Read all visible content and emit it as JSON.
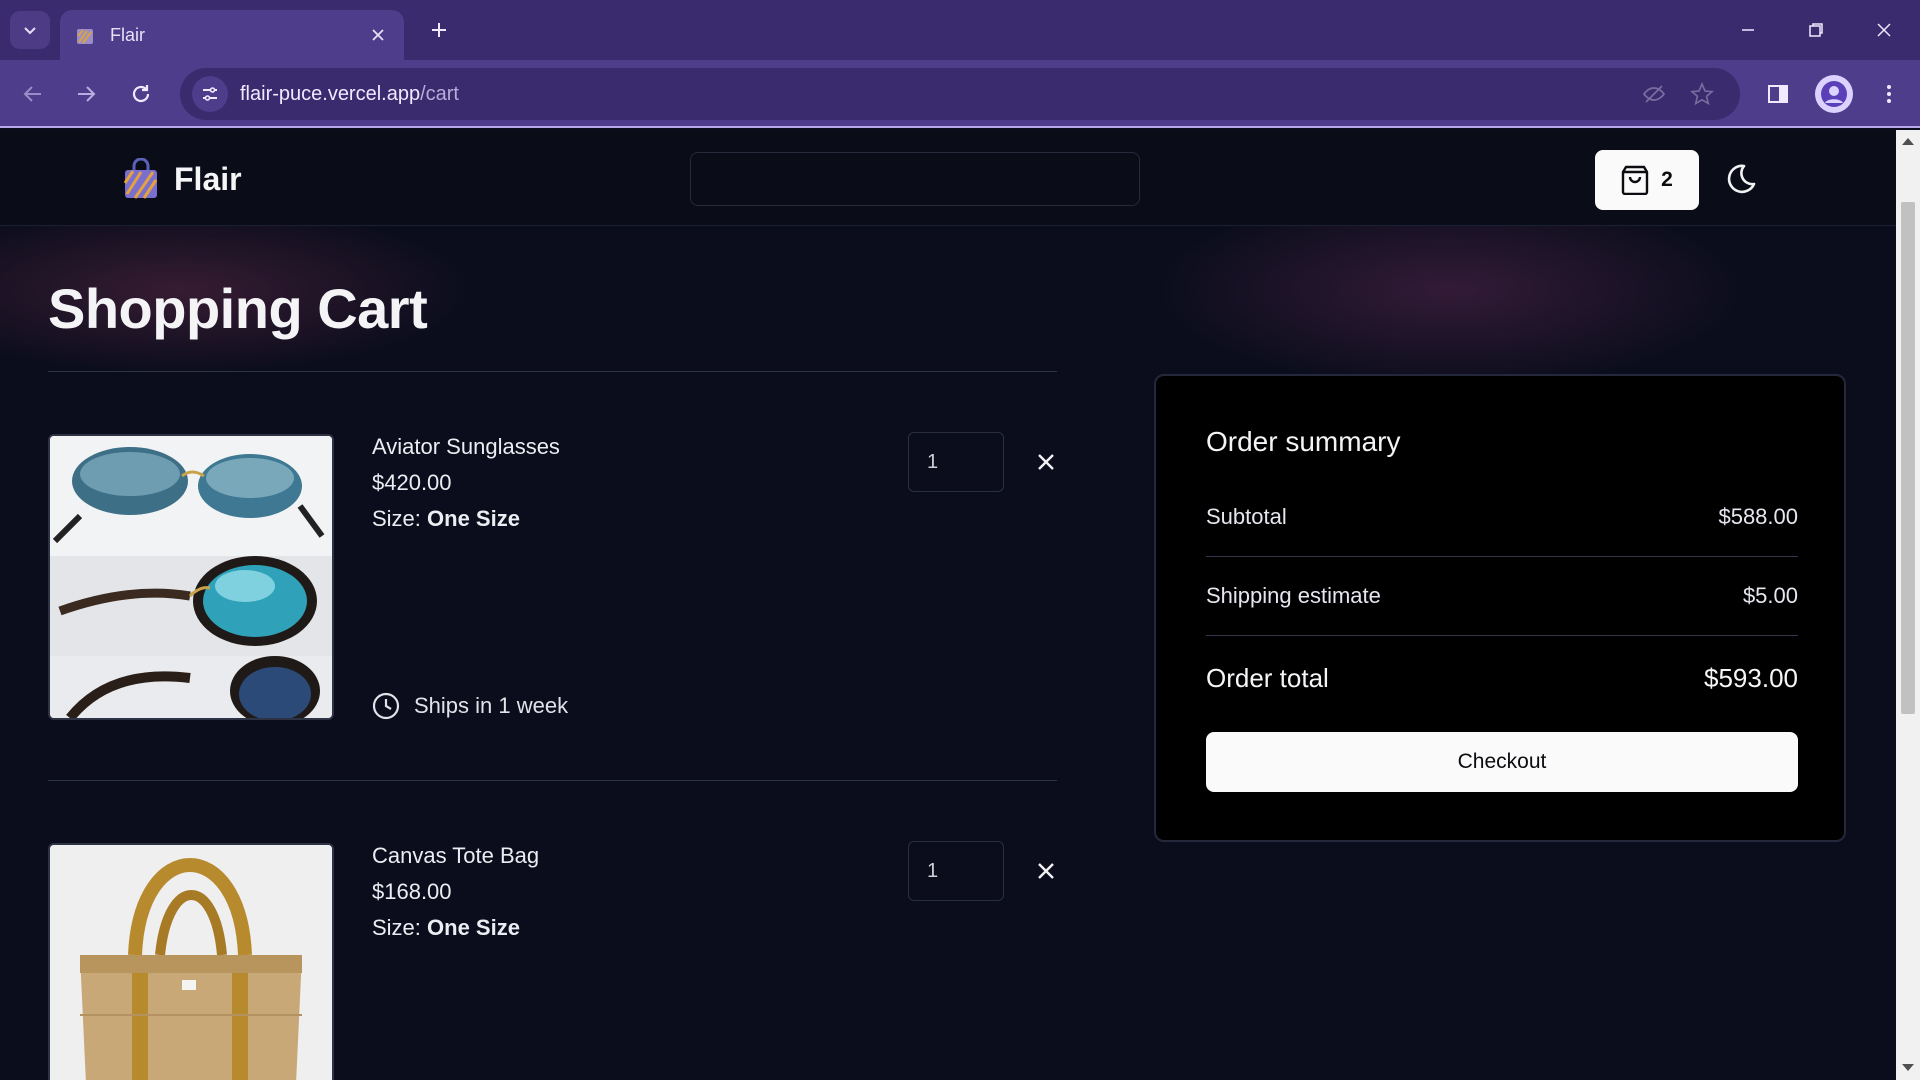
{
  "browser": {
    "tab_title": "Flair",
    "url_domain": "flair-puce.vercel.app",
    "url_path": "/cart"
  },
  "site": {
    "logo_name": "Flair",
    "cart_count": "2"
  },
  "page_title": "Shopping Cart",
  "cart_items": [
    {
      "name": "Aviator Sunglasses",
      "price": "$420.00",
      "size_label": "Size: ",
      "size_value": "One Size",
      "quantity": "1",
      "shipping": "Ships in 1 week"
    },
    {
      "name": "Canvas Tote Bag",
      "price": "$168.00",
      "size_label": "Size: ",
      "size_value": "One Size",
      "quantity": "1"
    }
  ],
  "summary": {
    "title": "Order summary",
    "subtotal_label": "Subtotal",
    "subtotal_value": "$588.00",
    "shipping_label": "Shipping estimate",
    "shipping_value": "$5.00",
    "total_label": "Order total",
    "total_value": "$593.00",
    "checkout_label": "Checkout"
  },
  "colors": {
    "browser_tabbar": "#3a2a6e",
    "browser_toolbar": "#4e3d8a",
    "page_background": "#0b0d1c",
    "summary_background": "#000000",
    "button_light": "#fafafa"
  },
  "icons": [
    "tab-search-icon",
    "favicon",
    "close-icon",
    "plus-icon",
    "minimize-icon",
    "restore-icon",
    "back-icon",
    "forward-icon",
    "reload-icon",
    "site-info-icon",
    "eye-off-icon",
    "star-icon",
    "side-panel-icon",
    "profile-icon",
    "kebab-menu-icon",
    "shopping-bag-icon",
    "moon-icon",
    "clock-icon"
  ]
}
